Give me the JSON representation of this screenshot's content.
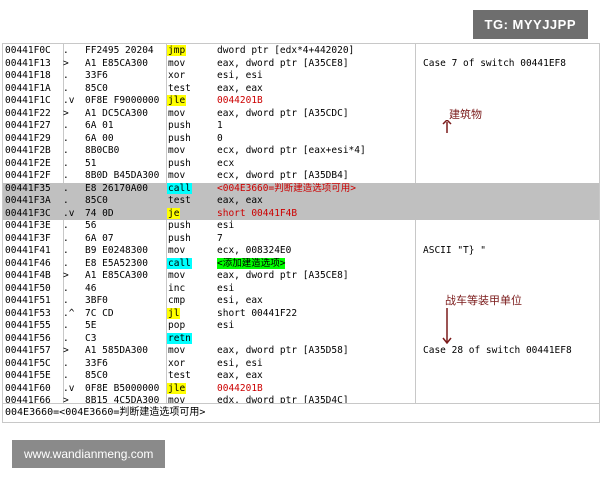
{
  "watermarks": {
    "top": "TG: MYYJJPP",
    "bottom": "www.wandianmeng.com"
  },
  "rows": [
    {
      "addr": "00441F0C",
      "mark": ".",
      "hex": "FF2495 20204",
      "mn": "jmp",
      "mn_style": "yellow",
      "op": "dword ptr [edx*4+442020]",
      "op_style": "",
      "comment": "",
      "sel": false
    },
    {
      "addr": "00441F13",
      "mark": ">",
      "hex": "A1 E85CA300",
      "mn": "mov",
      "mn_style": "",
      "op": "eax, dword ptr [A35CE8]",
      "op_style": "",
      "comment": "Case 7 of switch 00441EF8",
      "sel": false
    },
    {
      "addr": "00441F18",
      "mark": ".",
      "hex": "33F6",
      "mn": "xor",
      "mn_style": "",
      "op": "esi, esi",
      "op_style": "",
      "comment": "",
      "sel": false
    },
    {
      "addr": "00441F1A",
      "mark": ".",
      "hex": "85C0",
      "mn": "test",
      "mn_style": "",
      "op": "eax, eax",
      "op_style": "",
      "comment": "",
      "sel": false
    },
    {
      "addr": "00441F1C",
      "mark": ".v",
      "hex": "0F8E F9000000",
      "mn": "jle",
      "mn_style": "yellow",
      "op": "0044201B",
      "op_style": "red",
      "comment": "",
      "sel": false
    },
    {
      "addr": "00441F22",
      "mark": ">",
      "hex": "A1 DC5CA300",
      "mn": "mov",
      "mn_style": "",
      "op": "eax, dword ptr [A35CDC]",
      "op_style": "",
      "comment": "",
      "sel": false
    },
    {
      "addr": "00441F27",
      "mark": ".",
      "hex": "6A 01",
      "mn": "push",
      "mn_style": "",
      "op": "1",
      "op_style": "dark",
      "comment": "",
      "sel": false
    },
    {
      "addr": "00441F29",
      "mark": ".",
      "hex": "6A 00",
      "mn": "push",
      "mn_style": "",
      "op": "0",
      "op_style": "dark",
      "comment": "",
      "sel": false
    },
    {
      "addr": "00441F2B",
      "mark": ".",
      "hex": "8B0CB0",
      "mn": "mov",
      "mn_style": "",
      "op": "ecx, dword ptr [eax+esi*4]",
      "op_style": "",
      "comment": "",
      "sel": false
    },
    {
      "addr": "00441F2E",
      "mark": ".",
      "hex": "51",
      "mn": "push",
      "mn_style": "",
      "op": "ecx",
      "op_style": "",
      "comment": "",
      "sel": false
    },
    {
      "addr": "00441F2F",
      "mark": ".",
      "hex": "8B0D B45DA300",
      "mn": "mov",
      "mn_style": "",
      "op": "ecx, dword ptr [A35DB4]",
      "op_style": "",
      "comment": "",
      "sel": false
    },
    {
      "addr": "00441F35",
      "mark": ".",
      "hex": "E8 26170A00",
      "mn": "call",
      "mn_style": "cyan",
      "op": "<004E3660=判断建造选项可用>",
      "op_style": "red",
      "comment": "",
      "sel": true
    },
    {
      "addr": "00441F3A",
      "mark": ".",
      "hex": "85C0",
      "mn": "test",
      "mn_style": "",
      "op": "eax, eax",
      "op_style": "",
      "comment": "",
      "sel": true
    },
    {
      "addr": "00441F3C",
      "mark": ".v",
      "hex": "74 0D",
      "mn": "je",
      "mn_style": "yellow",
      "op": "short 00441F4B",
      "op_style": "red",
      "comment": "",
      "sel": true
    },
    {
      "addr": "00441F3E",
      "mark": ".",
      "hex": "56",
      "mn": "push",
      "mn_style": "",
      "op": "esi",
      "op_style": "",
      "comment": "",
      "sel": false
    },
    {
      "addr": "00441F3F",
      "mark": ".",
      "hex": "6A 07",
      "mn": "push",
      "mn_style": "",
      "op": "7",
      "op_style": "dark",
      "comment": "",
      "sel": false
    },
    {
      "addr": "00441F41",
      "mark": ".",
      "hex": "B9 E0248300",
      "mn": "mov",
      "mn_style": "",
      "op": "ecx, 008324E0",
      "op_style": "",
      "comment": "ASCII \"T} \"",
      "sel": false
    },
    {
      "addr": "00441F46",
      "mark": ".",
      "hex": "E8 E5A52300",
      "mn": "call",
      "mn_style": "cyan",
      "op": "<添加建造选项>",
      "op_style": "green",
      "comment": "",
      "sel": false
    },
    {
      "addr": "00441F4B",
      "mark": ">",
      "hex": "A1 E85CA300",
      "mn": "mov",
      "mn_style": "",
      "op": "eax, dword ptr [A35CE8]",
      "op_style": "",
      "comment": "",
      "sel": false
    },
    {
      "addr": "00441F50",
      "mark": ".",
      "hex": "46",
      "mn": "inc",
      "mn_style": "",
      "op": "esi",
      "op_style": "",
      "comment": "",
      "sel": false
    },
    {
      "addr": "00441F51",
      "mark": ".",
      "hex": "3BF0",
      "mn": "cmp",
      "mn_style": "",
      "op": "esi, eax",
      "op_style": "",
      "comment": "",
      "sel": false
    },
    {
      "addr": "00441F53",
      "mark": ".^",
      "hex": "7C CD",
      "mn": "jl",
      "mn_style": "yellow",
      "op": "short 00441F22",
      "op_style": "",
      "comment": "",
      "sel": false
    },
    {
      "addr": "00441F55",
      "mark": ".",
      "hex": "5E",
      "mn": "pop",
      "mn_style": "",
      "op": "esi",
      "op_style": "",
      "comment": "",
      "sel": false
    },
    {
      "addr": "00441F56",
      "mark": ".",
      "hex": "C3",
      "mn": "retn",
      "mn_style": "cyan",
      "op": "",
      "op_style": "",
      "comment": "",
      "sel": false
    },
    {
      "addr": "00441F57",
      "mark": ">",
      "hex": "A1 585DA300",
      "mn": "mov",
      "mn_style": "",
      "op": "eax, dword ptr [A35D58]",
      "op_style": "",
      "comment": "Case 28 of switch 00441EF8",
      "sel": false
    },
    {
      "addr": "00441F5C",
      "mark": ".",
      "hex": "33F6",
      "mn": "xor",
      "mn_style": "",
      "op": "esi, esi",
      "op_style": "",
      "comment": "",
      "sel": false
    },
    {
      "addr": "00441F5E",
      "mark": ".",
      "hex": "85C0",
      "mn": "test",
      "mn_style": "",
      "op": "eax, eax",
      "op_style": "",
      "comment": "",
      "sel": false
    },
    {
      "addr": "00441F60",
      "mark": ".v",
      "hex": "0F8E B5000000",
      "mn": "jle",
      "mn_style": "yellow",
      "op": "0044201B",
      "op_style": "red",
      "comment": "",
      "sel": false
    },
    {
      "addr": "00441F66",
      "mark": ">",
      "hex": "8B15 4C5DA300",
      "mn": "mov",
      "mn_style": "",
      "op": "edx, dword ptr [A35D4C]",
      "op_style": "",
      "comment": "",
      "sel": false
    }
  ],
  "status_text": "004E3660=<004E3660=判断建造选项可用>",
  "annotations": {
    "buildings": "建筑物",
    "vehicles": "战车等装甲单位"
  },
  "colors": {
    "selection": "#c0c0c0",
    "jump": "#ffff00",
    "call": "#00ffff",
    "label": "#00ff00",
    "annotation": "#7a1a1a"
  }
}
